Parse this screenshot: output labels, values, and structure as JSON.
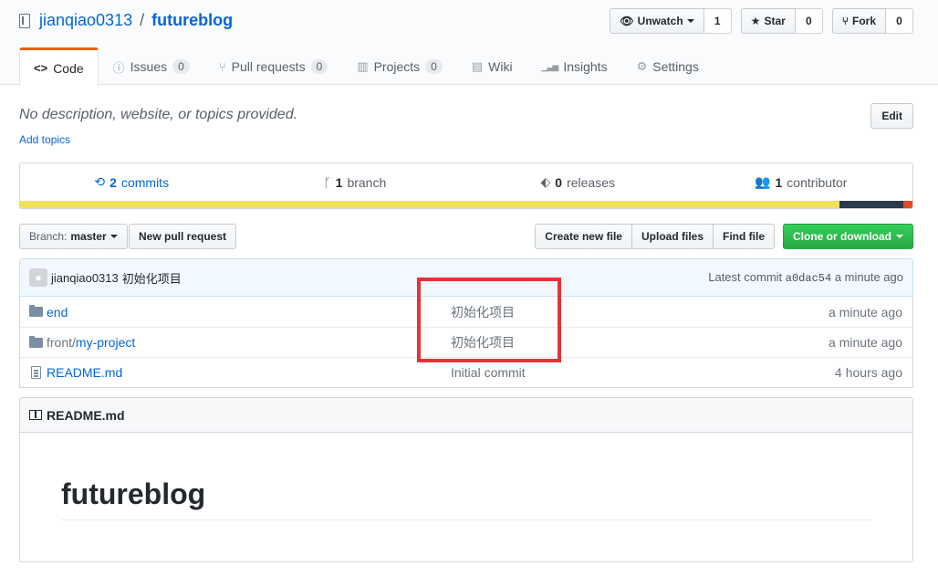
{
  "repo": {
    "owner": "jianqiao0313",
    "separator": "/",
    "name": "futureblog"
  },
  "actions": {
    "watch": {
      "label": "Unwatch",
      "count": "1"
    },
    "star": {
      "label": "Star",
      "count": "0"
    },
    "fork": {
      "label": "Fork",
      "count": "0"
    }
  },
  "tabs": [
    {
      "label": "Code",
      "icon": "code-icon",
      "glyph": "<>"
    },
    {
      "label": "Issues",
      "icon": "issue-icon",
      "glyph": "ⓘ",
      "count": "0"
    },
    {
      "label": "Pull requests",
      "icon": "pull-request-icon",
      "glyph": "⑂",
      "count": "0"
    },
    {
      "label": "Projects",
      "icon": "project-icon",
      "glyph": "▥",
      "count": "0"
    },
    {
      "label": "Wiki",
      "icon": "book-icon",
      "glyph": "▤"
    },
    {
      "label": "Insights",
      "icon": "graph-icon",
      "glyph": "▁▃▅"
    },
    {
      "label": "Settings",
      "icon": "gear-icon",
      "glyph": "⚙"
    }
  ],
  "description": {
    "text": "No description, website, or topics provided.",
    "add_topics": "Add topics",
    "edit_label": "Edit"
  },
  "summary": {
    "commits": {
      "num": "2",
      "label": "commits"
    },
    "branches": {
      "num": "1",
      "label": "branch"
    },
    "releases": {
      "num": "0",
      "label": "releases"
    },
    "contributors": {
      "num": "1",
      "label": "contributor"
    }
  },
  "language_colors": [
    "#f1e05a",
    "#2b3a4d",
    "#e34c26"
  ],
  "file_nav": {
    "branch_prefix": "Branch:",
    "branch_name": "master",
    "new_pull_request": "New pull request",
    "create_new_file": "Create new file",
    "upload_files": "Upload files",
    "find_file": "Find file",
    "clone": "Clone or download"
  },
  "latest_commit": {
    "author": "jianqiao0313",
    "message": "初始化项目",
    "prefix": "Latest commit",
    "sha": "a0dac54",
    "age": "a minute ago"
  },
  "files": [
    {
      "type": "folder",
      "prefix": "",
      "name": "end",
      "message": "初始化项目",
      "age": "a minute ago"
    },
    {
      "type": "folder",
      "prefix": "front/",
      "name": "my-project",
      "message": "初始化项目",
      "age": "a minute ago"
    },
    {
      "type": "file",
      "prefix": "",
      "name": "README.md",
      "message": "Initial commit",
      "age": "4 hours ago"
    }
  ],
  "readme": {
    "filename": "README.md",
    "title": "futureblog"
  },
  "highlight_color": "#e8323a"
}
